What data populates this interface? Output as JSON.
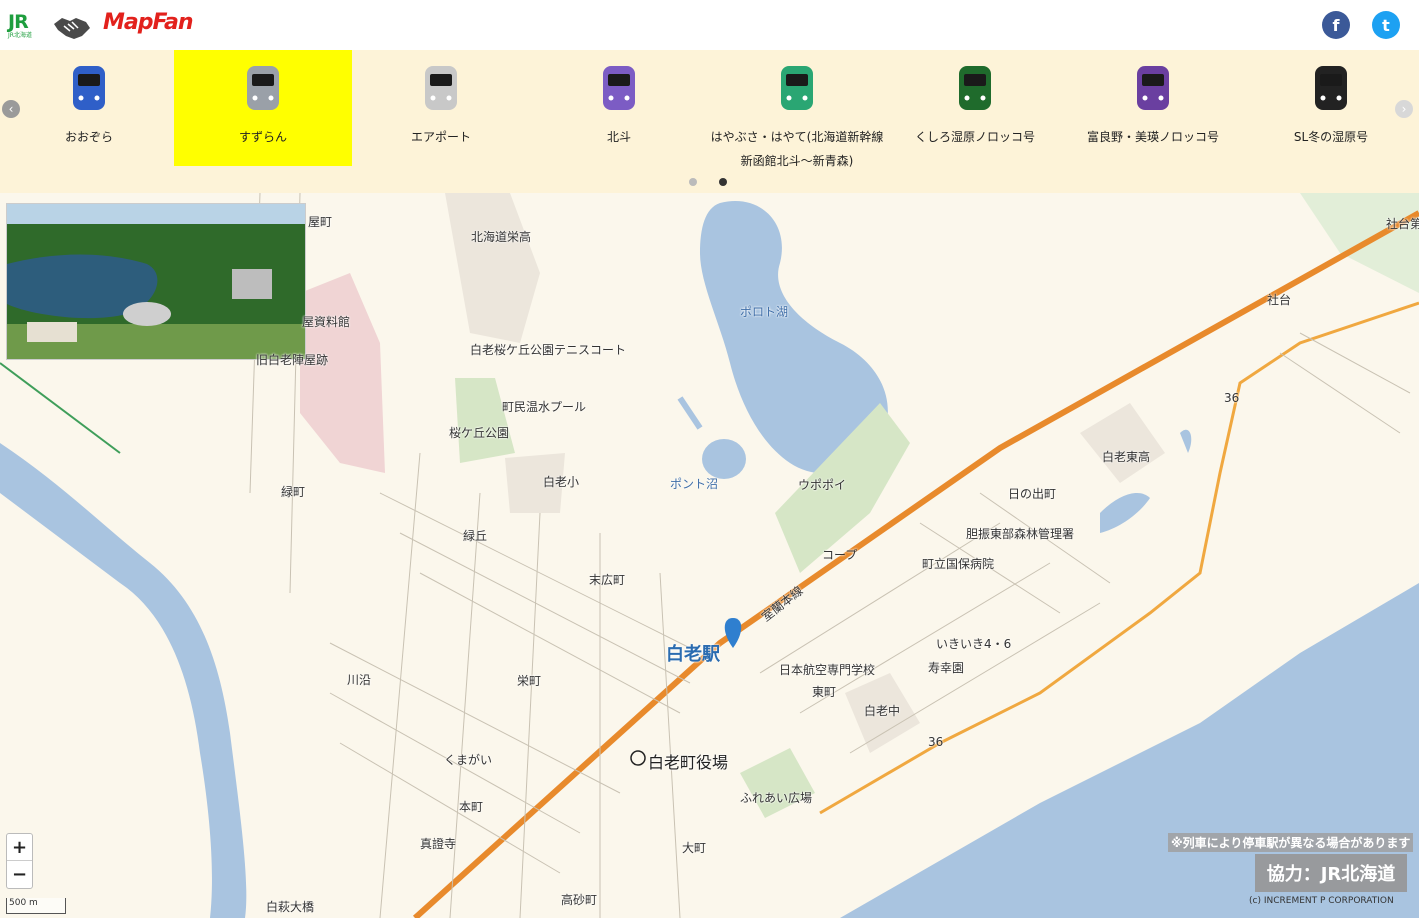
{
  "header": {
    "jr_logo": "JR",
    "jr_logo_sub": "JR北海道",
    "mapfan_logo": "MapFan",
    "facebook_icon": "f",
    "twitter_icon": "t"
  },
  "carousel": {
    "prev": "‹",
    "next": "›",
    "items": [
      {
        "label": "おおぞら",
        "color": "#2f5fc8"
      },
      {
        "label": "すずらん",
        "color": "#9aa0a8"
      },
      {
        "label": "エアポート",
        "color": "#c8c8c8"
      },
      {
        "label": "北斗",
        "color": "#7c5cc4"
      },
      {
        "label": "はやぶさ・はやて(北海道新幹線",
        "label2": "新函館北斗〜新青森)",
        "color": "#2aa673"
      },
      {
        "label": "くしろ湿原ノロッコ号",
        "color": "#1f6b2c"
      },
      {
        "label": "富良野・美瑛ノロッコ号",
        "color": "#6a3fa0"
      },
      {
        "label": "SL冬の湿原号",
        "color": "#222222"
      }
    ],
    "active_index": 1,
    "page_dots": 2,
    "active_dot": 1
  },
  "map": {
    "labels": {
      "yamachi": "屋町",
      "shiryokan": "屋資料館",
      "yashiki": "旧白老陣屋跡",
      "midoricho": "緑町",
      "eiko": "北海道栄高",
      "tennis": "白老桜ケ丘公園テニスコート",
      "pool": "町民温水プール",
      "sakuragaoka": "桜ケ丘公園",
      "shiraoi_sho": "白老小",
      "midorioka": "緑丘",
      "suehiro": "末広町",
      "poroto": "ポロト湖",
      "ponto": "ポント沼",
      "upopoy": "ウポポイ",
      "shadai": "社台",
      "shadai2": "社台第",
      "higashi_ko": "白老東高",
      "hinode": "日の出町",
      "forest": "胆振東部森林管理署",
      "coop_store": "コープ",
      "hospital": "町立国保病院",
      "muroran": "室蘭本線",
      "station": "白老駅",
      "ikiiki": "いきいき4・6",
      "jukoen": "寿幸園",
      "nikku": "日本航空専門学校",
      "higashimachi": "東町",
      "kawazoi": "川沿",
      "sakaemachi": "栄町",
      "chu": "白老中",
      "kumagai": "くまがい",
      "yakuba": "白老町役場",
      "fureai": "ふれあい広場",
      "honmachi": "本町",
      "shinshoji": "真證寺",
      "omachi": "大町",
      "takasago": "高砂町",
      "ohashi": "白萩大橋",
      "route36a": "36",
      "route36b": "36"
    },
    "zoom_in": "+",
    "zoom_out": "−",
    "scale": "500 m",
    "note": "※列車により停車駅が異なる場合があります",
    "cooperation": "協力：JR北海道",
    "copyright": "(c) INCREMENT P CORPORATION"
  }
}
